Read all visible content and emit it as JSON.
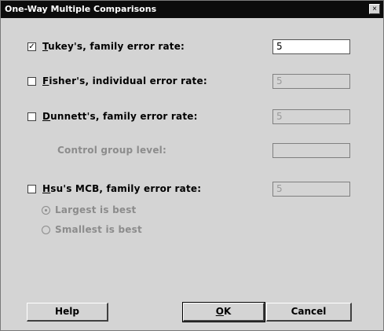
{
  "window": {
    "title": "One-Way Multiple Comparisons",
    "close_glyph": "×"
  },
  "options": {
    "tukey": {
      "label_accel": "T",
      "label_rest": "ukey's, family error rate:",
      "checked": true,
      "check_glyph": "✓",
      "value": "5"
    },
    "fisher": {
      "label_accel": "F",
      "label_rest": "isher's, individual error rate:",
      "checked": false,
      "value": "5"
    },
    "dunnett": {
      "label_accel": "D",
      "label_rest": "unnett's, family error rate:",
      "checked": false,
      "value": "5"
    },
    "control_group": {
      "label": "Control group level:",
      "value": ""
    },
    "hsu": {
      "label_accel": "H",
      "label_rest": "su's MCB, family error rate:",
      "checked": false,
      "value": "5"
    }
  },
  "hsu_radios": {
    "largest": {
      "label": "Largest is best",
      "selected": true
    },
    "smallest": {
      "label": "Smallest is best",
      "selected": false
    }
  },
  "buttons": {
    "help": {
      "label": "Help"
    },
    "ok": {
      "label_accel": "O",
      "label_rest": "K"
    },
    "cancel": {
      "label": "Cancel"
    }
  }
}
